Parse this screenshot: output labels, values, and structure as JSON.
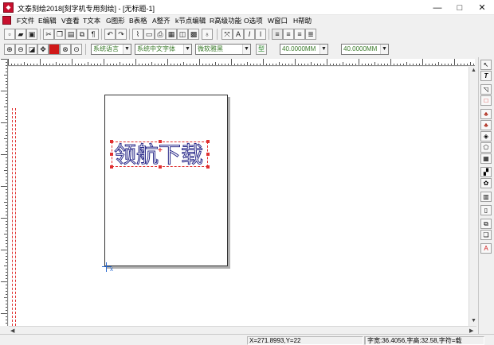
{
  "window": {
    "title": "文泰刻绘2018[刻字机专用刻绘] - [无标题-1]",
    "minimize": "—",
    "maximize": "□",
    "close": "✕"
  },
  "menu": [
    {
      "label": "F文件"
    },
    {
      "label": "E编辑"
    },
    {
      "label": "V查看"
    },
    {
      "label": "T文本"
    },
    {
      "label": "G图形"
    },
    {
      "label": "B表格"
    },
    {
      "label": "A整齐"
    },
    {
      "label": "k节点编辑"
    },
    {
      "label": "R高级功能"
    },
    {
      "label": "O选项"
    },
    {
      "label": "W窗口"
    },
    {
      "label": "H帮助"
    }
  ],
  "toolbar1": {
    "icons": [
      "new-file-icon",
      "open-folder-icon",
      "save-icon",
      "cut-icon",
      "copy-icon",
      "paste-icon",
      "clone-icon",
      "undo-icon",
      "redo-icon",
      "cut-plot-icon",
      "print-icon",
      "print-preview-icon",
      "export-icon",
      "import-icon",
      "bulb-icon",
      "rotate-icon",
      "text-frame-icon",
      "italic-icon",
      "text-cursor-icon",
      "align-left-icon",
      "align-center-icon",
      "align-right-icon",
      "justify-icon"
    ]
  },
  "toolbar2": {
    "language": "系统语言",
    "font_script": "系统中文字体",
    "font_name": "微软雅黑",
    "style_label": "型",
    "height_label": "高",
    "height_value": "40.0000MM",
    "width_label": "宽",
    "width_value": "40.0000MM"
  },
  "canvas": {
    "art_text": "领航下载",
    "center_mark": "+",
    "origin_label": "x",
    "guide_color": "#e03030",
    "outline_color": "#2b2b8a"
  },
  "status": {
    "coords": "X=271.8993,Y=22",
    "blank": "",
    "info": "字宽:36.4056,字高:32.58,字符=载"
  }
}
